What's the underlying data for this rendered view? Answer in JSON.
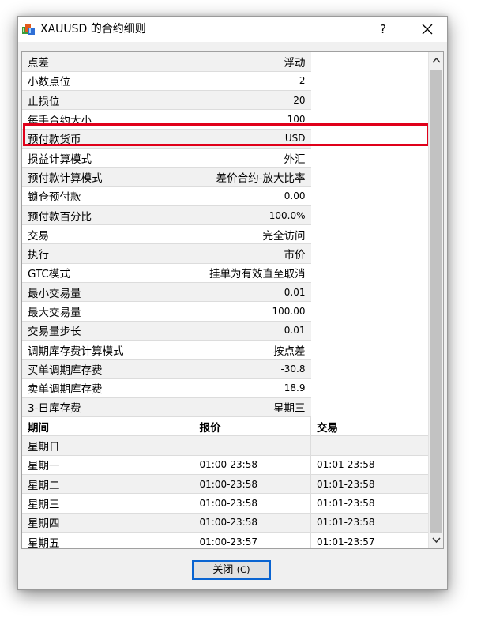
{
  "window": {
    "title": "XAUUSD 的合约细则",
    "help_label": "?",
    "close_label": "✕"
  },
  "properties": [
    {
      "key": "点差",
      "value": "浮动"
    },
    {
      "key": "小数点位",
      "value": "2"
    },
    {
      "key": "止损位",
      "value": "20"
    },
    {
      "key": "每手合约大小",
      "value": "100"
    },
    {
      "key": "预付款货币",
      "value": "USD"
    },
    {
      "key": "损益计算模式",
      "value": "外汇"
    },
    {
      "key": "预付款计算模式",
      "value": "差价合约-放大比率"
    },
    {
      "key": "锁仓预付款",
      "value": "0.00"
    },
    {
      "key": "预付款百分比",
      "value": "100.0%"
    },
    {
      "key": "交易",
      "value": "完全访问"
    },
    {
      "key": "执行",
      "value": "市价"
    },
    {
      "key": "GTC模式",
      "value": "挂单为有效直至取消"
    },
    {
      "key": "最小交易量",
      "value": "0.01"
    },
    {
      "key": "最大交易量",
      "value": "100.00"
    },
    {
      "key": "交易量步长",
      "value": "0.01"
    },
    {
      "key": "调期库存费计算模式",
      "value": "按点差"
    },
    {
      "key": "买单调期库存费",
      "value": "-30.8"
    },
    {
      "key": "卖单调期库存费",
      "value": "18.9"
    },
    {
      "key": "3-日库存费",
      "value": "星期三"
    }
  ],
  "sessions": {
    "headers": [
      "期间",
      "报价",
      "交易"
    ],
    "rows": [
      {
        "day": "星期日",
        "quote": "",
        "trade": ""
      },
      {
        "day": "星期一",
        "quote": "01:00-23:58",
        "trade": "01:01-23:58"
      },
      {
        "day": "星期二",
        "quote": "01:00-23:58",
        "trade": "01:01-23:58"
      },
      {
        "day": "星期三",
        "quote": "01:00-23:58",
        "trade": "01:01-23:58"
      },
      {
        "day": "星期四",
        "quote": "01:00-23:58",
        "trade": "01:01-23:58"
      },
      {
        "day": "星期五",
        "quote": "01:00-23:57",
        "trade": "01:01-23:57"
      }
    ]
  },
  "button": {
    "label": "关闭",
    "shortcut": "(C)"
  },
  "icons": {
    "app": "app-icon",
    "scroll_up": "chevron-up-icon",
    "scroll_down": "chevron-down-icon"
  },
  "colors": {
    "highlight": "#e0001a",
    "button_border": "#0a64d1"
  }
}
